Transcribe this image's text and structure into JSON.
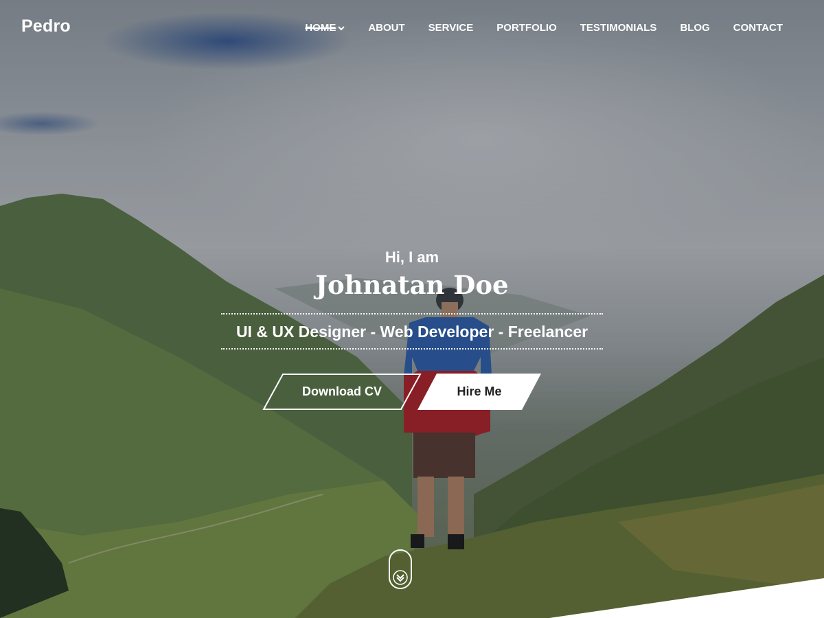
{
  "brand": "Pedro",
  "nav": {
    "items": [
      {
        "label": "HOME",
        "active": true,
        "has_dropdown": true
      },
      {
        "label": "ABOUT"
      },
      {
        "label": "SERVICE"
      },
      {
        "label": "PORTFOLIO"
      },
      {
        "label": "TESTIMONIALS"
      },
      {
        "label": "BLOG"
      },
      {
        "label": "CONTACT"
      }
    ]
  },
  "hero": {
    "greeting": "Hi, I am",
    "name": "Johnatan Doe",
    "roles": "UI & UX Designer - Web Developer - Freelancer",
    "buttons": {
      "download_cv": "Download CV",
      "hire_me": "Hire Me"
    },
    "background_image": "mountain valley landscape with hiker",
    "scroll_icon": "double-chevron-down-icon"
  },
  "colors": {
    "text": "#ffffff",
    "button_fill": "#ffffff",
    "button_text_dark": "#222222"
  }
}
